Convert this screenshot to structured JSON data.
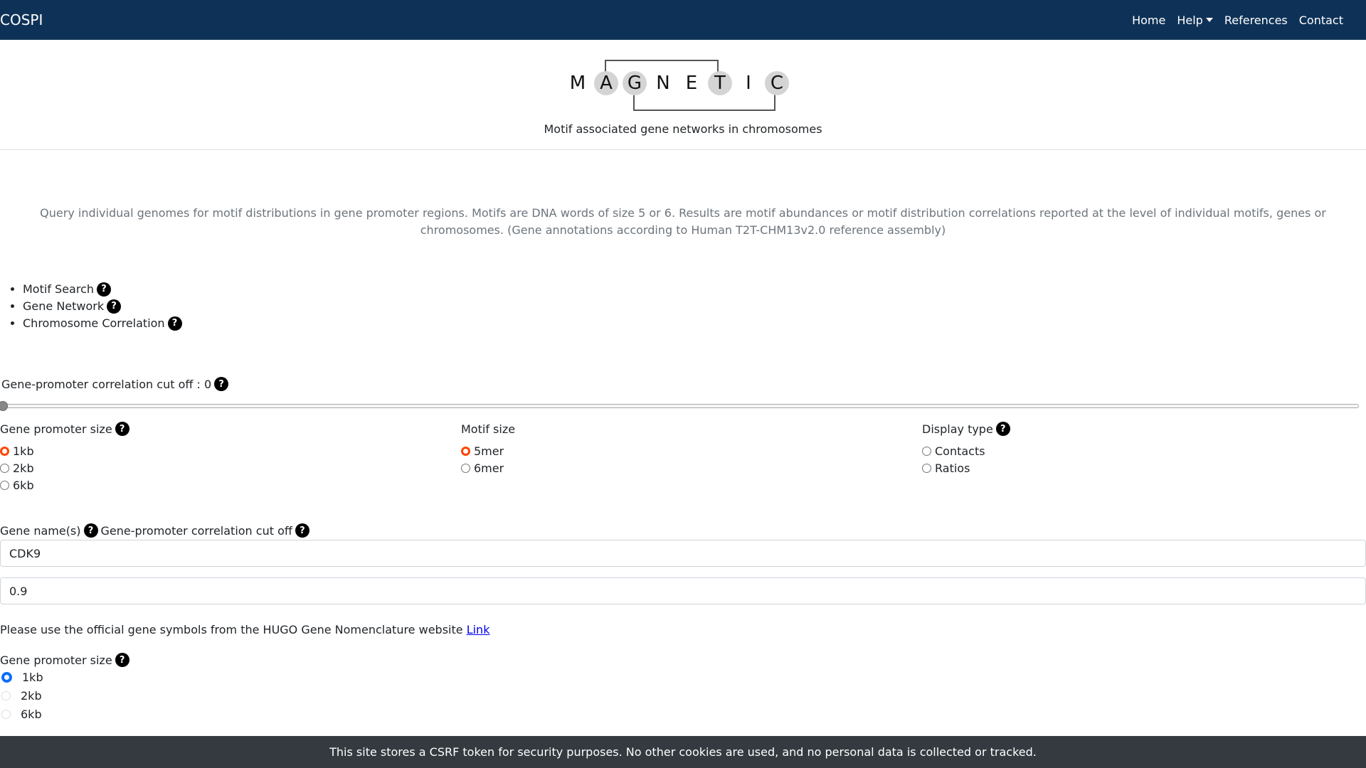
{
  "navbar": {
    "brand": "COSPI",
    "links": [
      "Home",
      "Help",
      "References",
      "Contact"
    ]
  },
  "header": {
    "logo_letters": [
      "M",
      "A",
      "G",
      "N",
      "E",
      "T",
      "I",
      "C"
    ],
    "tagline": "Motif associated gene networks in chromosomes"
  },
  "intro": "Query individual genomes for motif distributions in gene promoter regions. Motifs are DNA words of size 5 or 6. Results are motif abundances or motif distribution correlations reported at the level of individual motifs, genes or chromosomes. (Gene annotations according to Human T2T-CHM13v2.0 reference assembly)",
  "menu": [
    "Motif Search",
    "Gene Network",
    "Chromosome Correlation"
  ],
  "help_glyph": "?",
  "correlation": {
    "label": "Gene-promoter correlation cut off : 0",
    "value": 0
  },
  "promoter_size": {
    "title": "Gene promoter size",
    "options": [
      "1kb",
      "2kb",
      "6kb"
    ],
    "selected": "1kb"
  },
  "motif_size": {
    "title": "Motif size",
    "options": [
      "5mer",
      "6mer"
    ],
    "selected": "5mer"
  },
  "display_type": {
    "title": "Display type",
    "options": [
      "Contacts",
      "Ratios"
    ],
    "selected": null
  },
  "gene_section": {
    "gene_label": "Gene name(s)",
    "cutoff_label": "Gene-promoter correlation cut off",
    "gene_value": "CDK9",
    "cutoff_value": "0.9",
    "note": "Please use the official gene symbols from the HUGO Gene Nomenclature website",
    "link_text": "Link"
  },
  "promoter_size_2": {
    "title": "Gene promoter size",
    "options": [
      "1kb",
      "2kb",
      "6kb"
    ],
    "selected": "1kb"
  },
  "cookie_banner": "This site stores a CSRF token for security purposes. No other cookies are used, and no personal data is collected or tracked.",
  "colors": {
    "navbar": "#0e3257",
    "selected_radio": "#ff4500",
    "selected_radio_blue": "#0d6efd"
  }
}
